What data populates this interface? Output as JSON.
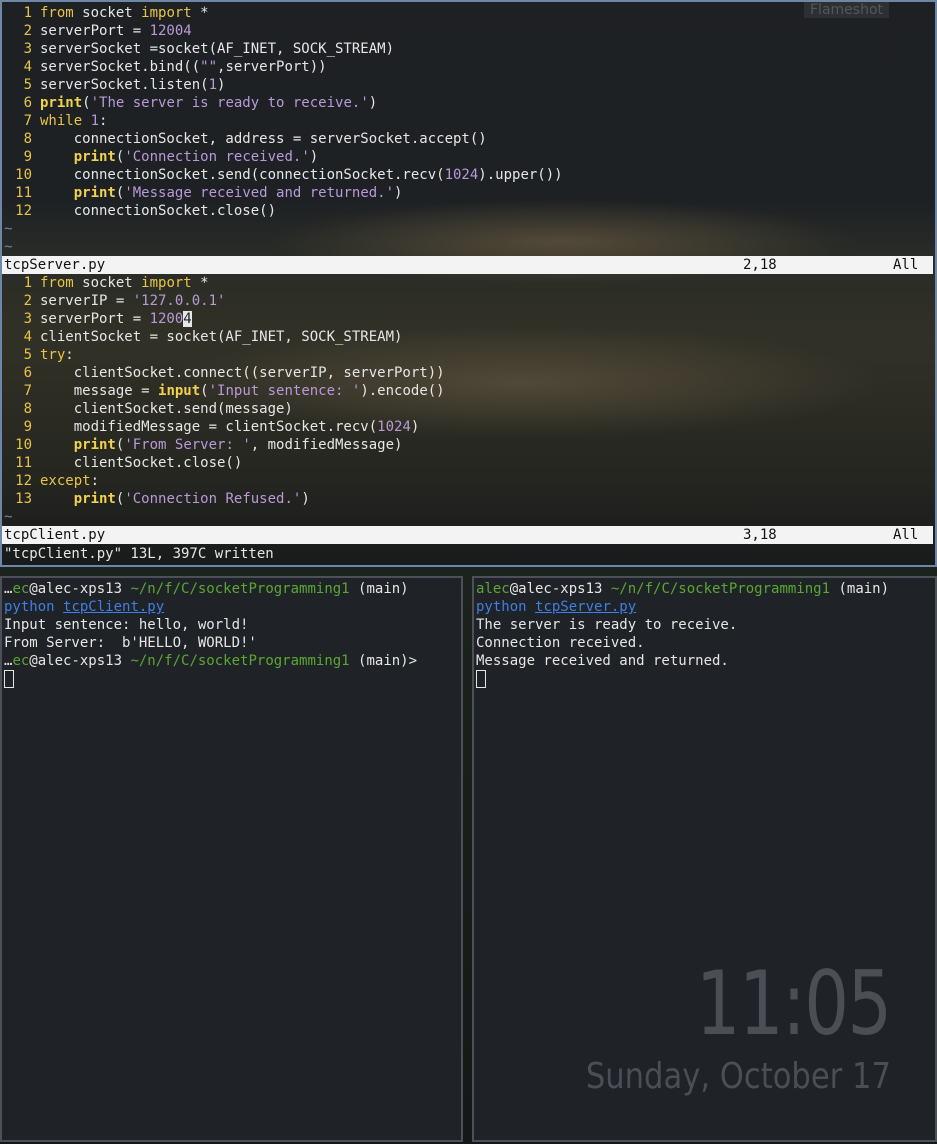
{
  "vim": {
    "server_lines": [
      {
        "n": "1",
        "parts": [
          [
            "kw",
            "from"
          ],
          [
            "w",
            " socket "
          ],
          [
            "kw",
            "import"
          ],
          [
            "w",
            " *"
          ]
        ]
      },
      {
        "n": "2",
        "parts": [
          [
            "w",
            "serverPort = "
          ],
          [
            "num",
            "12004"
          ]
        ]
      },
      {
        "n": "3",
        "parts": [
          [
            "w",
            "serverSocket =socket(AF_INET, SOCK_STREAM)"
          ]
        ]
      },
      {
        "n": "4",
        "parts": [
          [
            "w",
            "serverSocket.bind(("
          ],
          [
            "str",
            "\"\""
          ],
          [
            "w",
            ",serverPort))"
          ]
        ]
      },
      {
        "n": "5",
        "parts": [
          [
            "w",
            "serverSocket.listen("
          ],
          [
            "num",
            "1"
          ],
          [
            "w",
            ")"
          ]
        ]
      },
      {
        "n": "6",
        "parts": [
          [
            "fn",
            "print"
          ],
          [
            "w",
            "("
          ],
          [
            "str",
            "'The server is ready to receive.'"
          ],
          [
            "w",
            ")"
          ]
        ]
      },
      {
        "n": "7",
        "parts": [
          [
            "kw",
            "while"
          ],
          [
            "w",
            " "
          ],
          [
            "num",
            "1"
          ],
          [
            "w",
            ":"
          ]
        ]
      },
      {
        "n": "8",
        "parts": [
          [
            "w",
            "    connectionSocket, address = serverSocket.accept()"
          ]
        ]
      },
      {
        "n": "9",
        "parts": [
          [
            "w",
            "    "
          ],
          [
            "fn",
            "print"
          ],
          [
            "w",
            "("
          ],
          [
            "str",
            "'Connection received.'"
          ],
          [
            "w",
            ")"
          ]
        ]
      },
      {
        "n": "10",
        "parts": [
          [
            "w",
            "    connectionSocket.send(connectionSocket.recv("
          ],
          [
            "num",
            "1024"
          ],
          [
            "w",
            ").upper())"
          ]
        ]
      },
      {
        "n": "11",
        "parts": [
          [
            "w",
            "    "
          ],
          [
            "fn",
            "print"
          ],
          [
            "w",
            "("
          ],
          [
            "str",
            "'Message received and returned.'"
          ],
          [
            "w",
            ")"
          ]
        ]
      },
      {
        "n": "12",
        "parts": [
          [
            "w",
            "    connectionSocket.close()"
          ]
        ]
      }
    ],
    "server_tildes": 2,
    "server_status": {
      "filename": "tcpServer.py",
      "position": "2,18",
      "percent": "All"
    },
    "client_lines": [
      {
        "n": "1",
        "parts": [
          [
            "kw",
            "from"
          ],
          [
            "w",
            " socket "
          ],
          [
            "kw",
            "import"
          ],
          [
            "w",
            " *"
          ]
        ]
      },
      {
        "n": "2",
        "parts": [
          [
            "w",
            "serverIP = "
          ],
          [
            "str",
            "'127.0.0.1'"
          ]
        ]
      },
      {
        "n": "3",
        "parts": [
          [
            "w",
            "serverPort = "
          ],
          [
            "num",
            "1200"
          ],
          [
            "cur",
            "4"
          ]
        ]
      },
      {
        "n": "4",
        "parts": [
          [
            "w",
            "clientSocket = socket(AF_INET, SOCK_STREAM)"
          ]
        ]
      },
      {
        "n": "5",
        "parts": [
          [
            "kw",
            "try"
          ],
          [
            "w",
            ":"
          ]
        ]
      },
      {
        "n": "6",
        "parts": [
          [
            "w",
            "    clientSocket.connect((serverIP, serverPort))"
          ]
        ]
      },
      {
        "n": "7",
        "parts": [
          [
            "w",
            "    message = "
          ],
          [
            "fn",
            "input"
          ],
          [
            "w",
            "("
          ],
          [
            "str",
            "'Input sentence: '"
          ],
          [
            "w",
            ").encode()"
          ]
        ]
      },
      {
        "n": "8",
        "parts": [
          [
            "w",
            "    clientSocket.send(message)"
          ]
        ]
      },
      {
        "n": "9",
        "parts": [
          [
            "w",
            "    modifiedMessage = clientSocket.recv("
          ],
          [
            "num",
            "1024"
          ],
          [
            "w",
            ")"
          ]
        ]
      },
      {
        "n": "10",
        "parts": [
          [
            "w",
            "    "
          ],
          [
            "fn",
            "print"
          ],
          [
            "w",
            "("
          ],
          [
            "str",
            "'From Server: '"
          ],
          [
            "w",
            ", modifiedMessage)"
          ]
        ]
      },
      {
        "n": "11",
        "parts": [
          [
            "w",
            "    clientSocket.close()"
          ]
        ]
      },
      {
        "n": "12",
        "parts": [
          [
            "kw",
            "except"
          ],
          [
            "w",
            ":"
          ]
        ]
      },
      {
        "n": "13",
        "parts": [
          [
            "w",
            "    "
          ],
          [
            "fn",
            "print"
          ],
          [
            "w",
            "("
          ],
          [
            "str",
            "'Connection Refused.'"
          ],
          [
            "w",
            ")"
          ]
        ]
      }
    ],
    "client_tildes": 1,
    "client_status": {
      "filename": "tcpClient.py",
      "position": "3,18",
      "percent": "All"
    },
    "command_line": "\"tcpClient.py\" 13L, 397C written"
  },
  "overlay": {
    "flameshot": "Flameshot"
  },
  "term_left": {
    "lines": [
      [
        [
          "w",
          "…"
        ],
        [
          "g",
          "ec"
        ],
        [
          "w",
          "@alec-xps13 "
        ],
        [
          "g",
          "~/n/f/C/socketProgramming1"
        ],
        [
          "w",
          " (main)"
        ]
      ],
      [
        [
          "b",
          "python"
        ],
        [
          "w",
          " "
        ],
        [
          "bu",
          "tcpClient.py"
        ]
      ],
      [
        [
          "w",
          "Input sentence: hello, world!"
        ]
      ],
      [
        [
          "w",
          "From Server:  b'HELLO, WORLD!'"
        ]
      ],
      [
        [
          "w",
          "…"
        ],
        [
          "g",
          "ec"
        ],
        [
          "w",
          "@alec-xps13 "
        ],
        [
          "g",
          "~/n/f/C/socketProgramming1"
        ],
        [
          "w",
          " (main)>"
        ]
      ]
    ]
  },
  "term_right": {
    "lines": [
      [
        [
          "g",
          "alec"
        ],
        [
          "w",
          "@alec-xps13 "
        ],
        [
          "g",
          "~/n/f/C/socketProgramming1"
        ],
        [
          "w",
          " (main)"
        ]
      ],
      [
        [
          "b",
          "python"
        ],
        [
          "w",
          " "
        ],
        [
          "bu",
          "tcpServer.py"
        ]
      ],
      [
        [
          "w",
          "The server is ready to receive."
        ]
      ],
      [
        [
          "w",
          "Connection received."
        ]
      ],
      [
        [
          "w",
          "Message received and returned."
        ]
      ]
    ]
  },
  "clock": {
    "time": "11:05",
    "date": "Sunday, October 17"
  },
  "colors": {
    "line_number": "#e8c546",
    "keyword": "#e8c546",
    "literal": "#b99ad8",
    "prompt_green": "#5aa832",
    "command_blue": "#3f7fe6",
    "border": "#6f86a6"
  }
}
